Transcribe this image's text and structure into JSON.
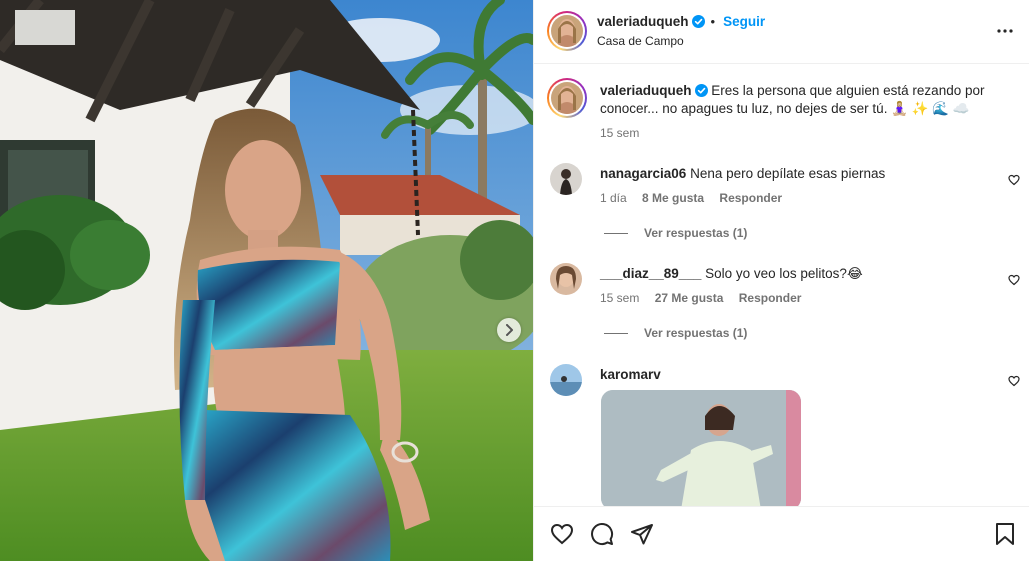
{
  "post": {
    "author": "valeriaduqueh",
    "follow_label": "Seguir",
    "location": "Casa de Campo",
    "caption_author": "valeriaduqueh",
    "caption_line1": "Eres la persona que alguien está rezando por",
    "caption_line2": "conocer... no apagues tu luz, no dejes de ser tú. 🧘🏼‍♀️ ✨ 🌊 ☁️",
    "caption_time": "15 sem"
  },
  "comments": [
    {
      "user": "nanagarcia06",
      "text": "Nena pero depílate esas piernas",
      "time": "1 día",
      "likes": "8 Me gusta",
      "reply": "Responder",
      "view_replies": "Ver respuestas (1)"
    },
    {
      "user": "___diaz__89___",
      "text": "Solo yo veo los pelitos?😂",
      "time": "15 sem",
      "likes": "27 Me gusta",
      "reply": "Responder",
      "view_replies": "Ver respuestas (1)"
    },
    {
      "user": "karomarv",
      "text": ""
    }
  ],
  "icons": {
    "verified": "verified-badge-icon",
    "more": "more-options-icon",
    "like": "heart-icon",
    "comment": "comment-icon",
    "share": "share-icon",
    "save": "bookmark-icon",
    "next": "chevron-right-icon"
  },
  "colors": {
    "accent": "#0095f6",
    "text": "#262626",
    "secondary": "#737373",
    "border": "#efefef"
  }
}
